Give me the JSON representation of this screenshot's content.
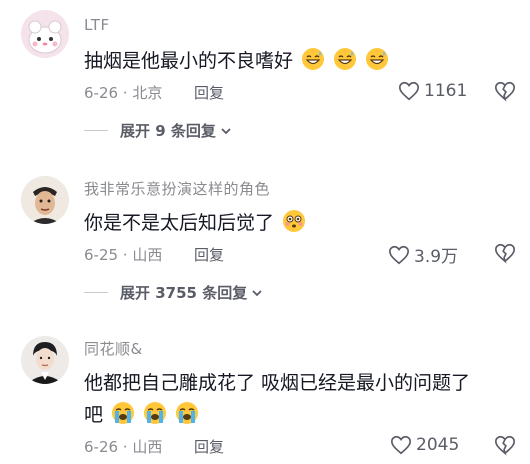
{
  "comments": [
    {
      "username": "LTF",
      "text": "抽烟是他最小的不良嗜好",
      "emoji_count": 3,
      "date": "6-26 · 北京",
      "reply_label": "回复",
      "likes": "1161",
      "expand_label": "展开 9 条回复"
    },
    {
      "username": "我非常乐意扮演这样的角色",
      "text": "你是不是太后知后觉了",
      "date": "6-25 · 山西",
      "reply_label": "回复",
      "likes": "3.9万",
      "expand_label": "展开 3755 条回复"
    },
    {
      "username": "同花顺&",
      "text_line1": "他都把自己雕成花了  吸烟已经是最小的问题了",
      "text_line2": "吧",
      "date": "6-26 · 山西",
      "reply_label": "回复",
      "likes": "2045"
    }
  ],
  "colors": {
    "text": "#161823",
    "secondary": "#8a8b91",
    "emoji_yellow": "#ffc83a"
  }
}
